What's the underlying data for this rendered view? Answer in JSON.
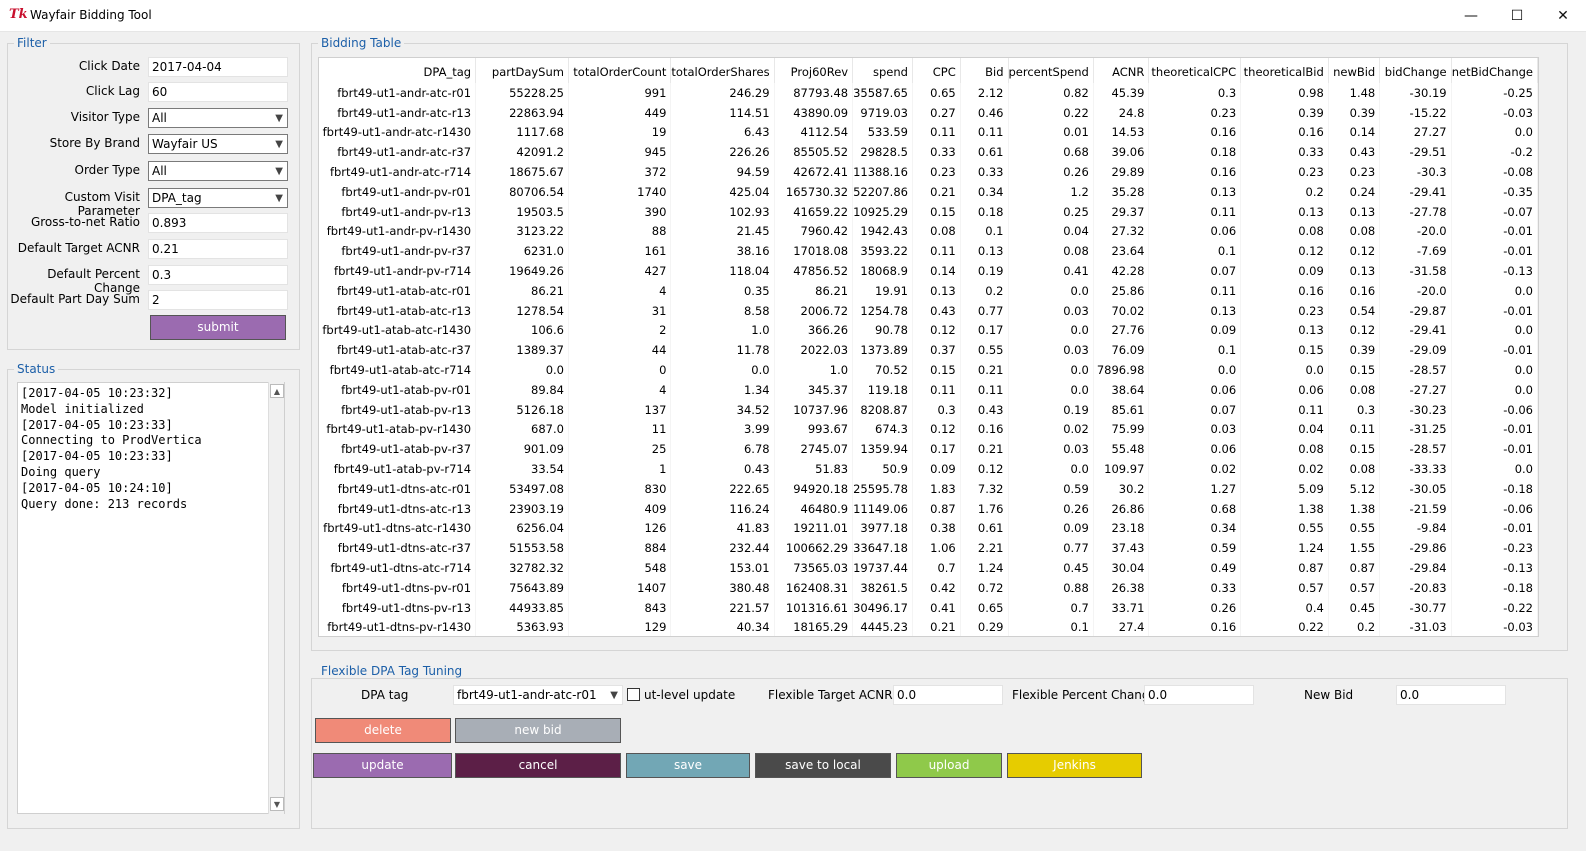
{
  "window": {
    "title": "Wayfair Bidding Tool",
    "icon": "Tk"
  },
  "filter": {
    "title": "Filter",
    "fields": [
      {
        "label": "Click Date",
        "value": "2017-04-04",
        "type": "entry"
      },
      {
        "label": "Click Lag",
        "value": "60",
        "type": "entry"
      },
      {
        "label": "Visitor Type",
        "value": "All",
        "type": "combo"
      },
      {
        "label": "Store By Brand",
        "value": "Wayfair US",
        "type": "combo"
      },
      {
        "label": "Order Type",
        "value": "All",
        "type": "combo"
      },
      {
        "label": "Custom Visit Parameter",
        "value": "DPA_tag",
        "type": "combo"
      },
      {
        "label": "Gross-to-net Ratio",
        "value": "0.893",
        "type": "entry"
      },
      {
        "label": "Default Target ACNR",
        "value": "0.21",
        "type": "entry"
      },
      {
        "label": "Default Percent Change",
        "value": "0.3",
        "type": "entry"
      },
      {
        "label": "Default Part Day Sum",
        "value": "2",
        "type": "entry"
      }
    ],
    "submit_label": "submit"
  },
  "status": {
    "title": "Status",
    "text": "[2017-04-05 10:23:32]\nModel initialized\n[2017-04-05 10:23:33]\nConnecting to ProdVertica\n[2017-04-05 10:23:33]\nDoing query\n[2017-04-05 10:24:10]\nQuery done: 213 records"
  },
  "bidding_table": {
    "title": "Bidding Table",
    "columns": [
      "DPA_tag",
      "partDaySum",
      "totalOrderCount",
      "totalOrderShares",
      "Proj60Rev",
      "spend",
      "CPC",
      "Bid",
      "percentSpend",
      "ACNR",
      "theoreticalCPC",
      "theoreticalBid",
      "newBid",
      "bidChange",
      "netBidChange"
    ],
    "rows": [
      [
        "fbrt49-ut1-andr-atc-r01",
        "55228.25",
        "991",
        "246.29",
        "87793.48",
        "35587.65",
        "0.65",
        "2.12",
        "0.82",
        "45.39",
        "0.3",
        "0.98",
        "1.48",
        "-30.19",
        "-0.25"
      ],
      [
        "fbrt49-ut1-andr-atc-r13",
        "22863.94",
        "449",
        "114.51",
        "43890.09",
        "9719.03",
        "0.27",
        "0.46",
        "0.22",
        "24.8",
        "0.23",
        "0.39",
        "0.39",
        "-15.22",
        "-0.03"
      ],
      [
        "fbrt49-ut1-andr-atc-r1430",
        "1117.68",
        "19",
        "6.43",
        "4112.54",
        "533.59",
        "0.11",
        "0.11",
        "0.01",
        "14.53",
        "0.16",
        "0.16",
        "0.14",
        "27.27",
        "0.0"
      ],
      [
        "fbrt49-ut1-andr-atc-r37",
        "42091.2",
        "945",
        "226.26",
        "85505.52",
        "29828.5",
        "0.33",
        "0.61",
        "0.68",
        "39.06",
        "0.18",
        "0.33",
        "0.43",
        "-29.51",
        "-0.2"
      ],
      [
        "fbrt49-ut1-andr-atc-r714",
        "18675.67",
        "372",
        "94.59",
        "42672.41",
        "11388.16",
        "0.23",
        "0.33",
        "0.26",
        "29.89",
        "0.16",
        "0.23",
        "0.23",
        "-30.3",
        "-0.08"
      ],
      [
        "fbrt49-ut1-andr-pv-r01",
        "80706.54",
        "1740",
        "425.04",
        "165730.32",
        "52207.86",
        "0.21",
        "0.34",
        "1.2",
        "35.28",
        "0.13",
        "0.2",
        "0.24",
        "-29.41",
        "-0.35"
      ],
      [
        "fbrt49-ut1-andr-pv-r13",
        "19503.5",
        "390",
        "102.93",
        "41659.22",
        "10925.29",
        "0.15",
        "0.18",
        "0.25",
        "29.37",
        "0.11",
        "0.13",
        "0.13",
        "-27.78",
        "-0.07"
      ],
      [
        "fbrt49-ut1-andr-pv-r1430",
        "3123.22",
        "88",
        "21.45",
        "7960.42",
        "1942.43",
        "0.08",
        "0.1",
        "0.04",
        "27.32",
        "0.06",
        "0.08",
        "0.08",
        "-20.0",
        "-0.01"
      ],
      [
        "fbrt49-ut1-andr-pv-r37",
        "6231.0",
        "161",
        "38.16",
        "17018.08",
        "3593.22",
        "0.11",
        "0.13",
        "0.08",
        "23.64",
        "0.1",
        "0.12",
        "0.12",
        "-7.69",
        "-0.01"
      ],
      [
        "fbrt49-ut1-andr-pv-r714",
        "19649.26",
        "427",
        "118.04",
        "47856.52",
        "18068.9",
        "0.14",
        "0.19",
        "0.41",
        "42.28",
        "0.07",
        "0.09",
        "0.13",
        "-31.58",
        "-0.13"
      ],
      [
        "fbrt49-ut1-atab-atc-r01",
        "86.21",
        "4",
        "0.35",
        "86.21",
        "19.91",
        "0.13",
        "0.2",
        "0.0",
        "25.86",
        "0.11",
        "0.16",
        "0.16",
        "-20.0",
        "0.0"
      ],
      [
        "fbrt49-ut1-atab-atc-r13",
        "1278.54",
        "31",
        "8.58",
        "2006.72",
        "1254.78",
        "0.43",
        "0.77",
        "0.03",
        "70.02",
        "0.13",
        "0.23",
        "0.54",
        "-29.87",
        "-0.01"
      ],
      [
        "fbrt49-ut1-atab-atc-r1430",
        "106.6",
        "2",
        "1.0",
        "366.26",
        "90.78",
        "0.12",
        "0.17",
        "0.0",
        "27.76",
        "0.09",
        "0.13",
        "0.12",
        "-29.41",
        "0.0"
      ],
      [
        "fbrt49-ut1-atab-atc-r37",
        "1389.37",
        "44",
        "11.78",
        "2022.03",
        "1373.89",
        "0.37",
        "0.55",
        "0.03",
        "76.09",
        "0.1",
        "0.15",
        "0.39",
        "-29.09",
        "-0.01"
      ],
      [
        "fbrt49-ut1-atab-atc-r714",
        "0.0",
        "0",
        "0.0",
        "1.0",
        "70.52",
        "0.15",
        "0.21",
        "0.0",
        "7896.98",
        "0.0",
        "0.0",
        "0.15",
        "-28.57",
        "0.0"
      ],
      [
        "fbrt49-ut1-atab-pv-r01",
        "89.84",
        "4",
        "1.34",
        "345.37",
        "119.18",
        "0.11",
        "0.11",
        "0.0",
        "38.64",
        "0.06",
        "0.06",
        "0.08",
        "-27.27",
        "0.0"
      ],
      [
        "fbrt49-ut1-atab-pv-r13",
        "5126.18",
        "137",
        "34.52",
        "10737.96",
        "8208.87",
        "0.3",
        "0.43",
        "0.19",
        "85.61",
        "0.07",
        "0.11",
        "0.3",
        "-30.23",
        "-0.06"
      ],
      [
        "fbrt49-ut1-atab-pv-r1430",
        "687.0",
        "11",
        "3.99",
        "993.67",
        "674.3",
        "0.12",
        "0.16",
        "0.02",
        "75.99",
        "0.03",
        "0.04",
        "0.11",
        "-31.25",
        "-0.01"
      ],
      [
        "fbrt49-ut1-atab-pv-r37",
        "901.09",
        "25",
        "6.78",
        "2745.07",
        "1359.94",
        "0.17",
        "0.21",
        "0.03",
        "55.48",
        "0.06",
        "0.08",
        "0.15",
        "-28.57",
        "-0.01"
      ],
      [
        "fbrt49-ut1-atab-pv-r714",
        "33.54",
        "1",
        "0.43",
        "51.83",
        "50.9",
        "0.09",
        "0.12",
        "0.0",
        "109.97",
        "0.02",
        "0.02",
        "0.08",
        "-33.33",
        "0.0"
      ],
      [
        "fbrt49-ut1-dtns-atc-r01",
        "53497.08",
        "830",
        "222.65",
        "94920.18",
        "25595.78",
        "1.83",
        "7.32",
        "0.59",
        "30.2",
        "1.27",
        "5.09",
        "5.12",
        "-30.05",
        "-0.18"
      ],
      [
        "fbrt49-ut1-dtns-atc-r13",
        "23903.19",
        "409",
        "116.24",
        "46480.9",
        "11149.06",
        "0.87",
        "1.76",
        "0.26",
        "26.86",
        "0.68",
        "1.38",
        "1.38",
        "-21.59",
        "-0.06"
      ],
      [
        "fbrt49-ut1-dtns-atc-r1430",
        "6256.04",
        "126",
        "41.83",
        "19211.01",
        "3977.18",
        "0.38",
        "0.61",
        "0.09",
        "23.18",
        "0.34",
        "0.55",
        "0.55",
        "-9.84",
        "-0.01"
      ],
      [
        "fbrt49-ut1-dtns-atc-r37",
        "51553.58",
        "884",
        "232.44",
        "100662.29",
        "33647.18",
        "1.06",
        "2.21",
        "0.77",
        "37.43",
        "0.59",
        "1.24",
        "1.55",
        "-29.86",
        "-0.23"
      ],
      [
        "fbrt49-ut1-dtns-atc-r714",
        "32782.32",
        "548",
        "153.01",
        "73565.03",
        "19737.44",
        "0.7",
        "1.24",
        "0.45",
        "30.04",
        "0.49",
        "0.87",
        "0.87",
        "-29.84",
        "-0.13"
      ],
      [
        "fbrt49-ut1-dtns-pv-r01",
        "75643.89",
        "1407",
        "380.48",
        "162408.31",
        "38261.5",
        "0.42",
        "0.72",
        "0.88",
        "26.38",
        "0.33",
        "0.57",
        "0.57",
        "-20.83",
        "-0.18"
      ],
      [
        "fbrt49-ut1-dtns-pv-r13",
        "44933.85",
        "843",
        "221.57",
        "101316.61",
        "30496.17",
        "0.41",
        "0.65",
        "0.7",
        "33.71",
        "0.26",
        "0.4",
        "0.45",
        "-30.77",
        "-0.22"
      ],
      [
        "fbrt49-ut1-dtns-pv-r1430",
        "5363.93",
        "129",
        "40.34",
        "18165.29",
        "4445.23",
        "0.21",
        "0.29",
        "0.1",
        "27.4",
        "0.16",
        "0.22",
        "0.2",
        "-31.03",
        "-0.03"
      ]
    ]
  },
  "tuning": {
    "title": "Flexible DPA Tag Tuning",
    "dpa_tag_label": "DPA tag",
    "dpa_tag_value": "fbrt49-ut1-andr-atc-r01",
    "ut_level_label": "ut-level update",
    "target_acnr_label": "Flexible Target ACNR",
    "target_acnr_value": "0.0",
    "percent_change_label": "Flexible Percent Change",
    "percent_change_value": "0.0",
    "new_bid_label": "New Bid",
    "new_bid_value": "0.0",
    "buttons": {
      "delete": "delete",
      "new_bid": "new bid",
      "update": "update",
      "cancel": "cancel",
      "save": "save",
      "save_to_local": "save to local",
      "upload": "upload",
      "jenkins": "Jenkins"
    }
  },
  "colors": {
    "submit": "#9b6bb0",
    "delete": "#f08a78",
    "new_bid": "#a8aeb6",
    "update": "#9b6bb0",
    "cancel": "#5c1f47",
    "save": "#72a7b5",
    "save_to_local": "#4a4a4a",
    "upload": "#8fc94a",
    "jenkins": "#e6cc00",
    "label_blue": "#1c5fa8"
  }
}
